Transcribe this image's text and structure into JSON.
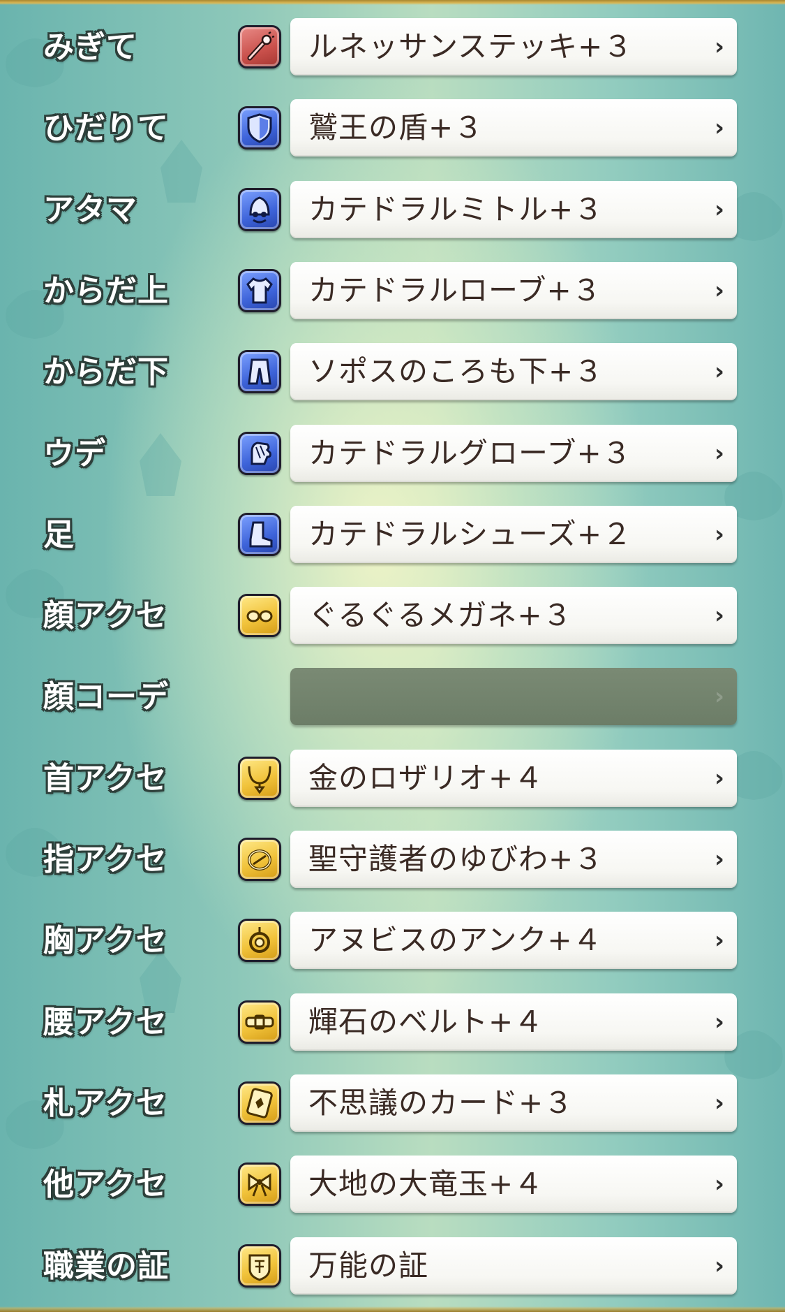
{
  "equipment": [
    {
      "slot": "みぎて",
      "item": "ルネッサンステッキ+３",
      "icon": "staff-icon",
      "icon_type": "weapon",
      "chevron": "›"
    },
    {
      "slot": "ひだりて",
      "item": "鷲王の盾+３",
      "icon": "shield-icon",
      "icon_type": "armor",
      "chevron": "›"
    },
    {
      "slot": "アタマ",
      "item": "カテドラルミトル+３",
      "icon": "head-icon",
      "icon_type": "armor",
      "chevron": "›"
    },
    {
      "slot": "からだ上",
      "item": "カテドラルローブ+３",
      "icon": "body-top-icon",
      "icon_type": "armor",
      "chevron": "›"
    },
    {
      "slot": "からだ下",
      "item": "ソポスのころも下+３",
      "icon": "body-bottom-icon",
      "icon_type": "armor",
      "chevron": "›"
    },
    {
      "slot": "ウデ",
      "item": "カテドラルグローブ+３",
      "icon": "glove-icon",
      "icon_type": "armor",
      "chevron": "›"
    },
    {
      "slot": "足",
      "item": "カテドラルシューズ+２",
      "icon": "boot-icon",
      "icon_type": "armor",
      "chevron": "›"
    },
    {
      "slot": "顔アクセ",
      "item": "ぐるぐるメガネ+３",
      "icon": "face-accessory-icon",
      "icon_type": "accessory",
      "chevron": "›"
    },
    {
      "slot": "顔コーデ",
      "item": "",
      "icon": "",
      "icon_type": "none",
      "chevron": "›"
    },
    {
      "slot": "首アクセ",
      "item": "金のロザリオ+４",
      "icon": "necklace-icon",
      "icon_type": "accessory",
      "chevron": "›"
    },
    {
      "slot": "指アクセ",
      "item": "聖守護者のゆびわ+３",
      "icon": "ring-icon",
      "icon_type": "accessory",
      "chevron": "›"
    },
    {
      "slot": "胸アクセ",
      "item": "アヌビスのアンク+４",
      "icon": "chest-accessory-icon",
      "icon_type": "accessory",
      "chevron": "›"
    },
    {
      "slot": "腰アクセ",
      "item": "輝石のベルト+４",
      "icon": "belt-icon",
      "icon_type": "accessory",
      "chevron": "›"
    },
    {
      "slot": "札アクセ",
      "item": "不思議のカード+３",
      "icon": "card-icon",
      "icon_type": "accessory",
      "chevron": "›"
    },
    {
      "slot": "他アクセ",
      "item": "大地の大竜玉+４",
      "icon": "ribbon-icon",
      "icon_type": "accessory",
      "chevron": "›"
    },
    {
      "slot": "職業の証",
      "item": "万能の証",
      "icon": "emblem-icon",
      "icon_type": "accessory",
      "chevron": "›"
    }
  ],
  "colors": {
    "weapon_icon": "#c9504b",
    "armor_icon": "#3d63d9",
    "accessory_icon": "#f1c33b",
    "empty_slot": "#6c7d67",
    "item_text": "#3a2a24"
  }
}
